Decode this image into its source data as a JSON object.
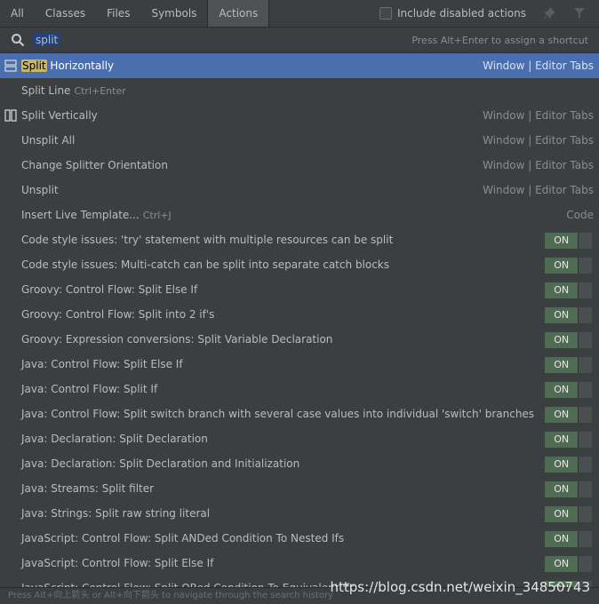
{
  "tabs": [
    "All",
    "Classes",
    "Files",
    "Symbols",
    "Actions"
  ],
  "include_disabled": "Include disabled actions",
  "search": {
    "value": "split",
    "hint": "Press Alt+Enter to assign a shortcut"
  },
  "rows": [
    {
      "pre": "",
      "hl": "Split",
      "post": " Horizontally",
      "shortcut": "",
      "loc": "Window | Editor Tabs",
      "toggle": false,
      "icon": "split-horizontally-icon"
    },
    {
      "pre": "Split Line",
      "hl": "",
      "post": "",
      "shortcut": "Ctrl+Enter",
      "loc": "",
      "toggle": false,
      "icon": ""
    },
    {
      "pre": "Split Vertically",
      "hl": "",
      "post": "",
      "shortcut": "",
      "loc": "Window | Editor Tabs",
      "toggle": false,
      "icon": "split-vertically-icon"
    },
    {
      "pre": "Unsplit All",
      "hl": "",
      "post": "",
      "shortcut": "",
      "loc": "Window | Editor Tabs",
      "toggle": false,
      "icon": ""
    },
    {
      "pre": "Change Splitter Orientation",
      "hl": "",
      "post": "",
      "shortcut": "",
      "loc": "Window | Editor Tabs",
      "toggle": false,
      "icon": ""
    },
    {
      "pre": "Unsplit",
      "hl": "",
      "post": "",
      "shortcut": "",
      "loc": "Window | Editor Tabs",
      "toggle": false,
      "icon": ""
    },
    {
      "pre": "Insert Live Template...",
      "hl": "",
      "post": "",
      "shortcut": "Ctrl+J",
      "loc": "Code",
      "toggle": false,
      "icon": ""
    },
    {
      "pre": "Code style issues: 'try' statement with multiple resources can be split",
      "hl": "",
      "post": "",
      "shortcut": "",
      "loc": "",
      "toggle": true,
      "icon": ""
    },
    {
      "pre": "Code style issues: Multi-catch can be split into separate catch blocks",
      "hl": "",
      "post": "",
      "shortcut": "",
      "loc": "",
      "toggle": true,
      "icon": ""
    },
    {
      "pre": "Groovy: Control Flow: Split Else If",
      "hl": "",
      "post": "",
      "shortcut": "",
      "loc": "",
      "toggle": true,
      "icon": ""
    },
    {
      "pre": "Groovy: Control Flow: Split into 2 if's",
      "hl": "",
      "post": "",
      "shortcut": "",
      "loc": "",
      "toggle": true,
      "icon": ""
    },
    {
      "pre": "Groovy: Expression conversions: Split Variable Declaration",
      "hl": "",
      "post": "",
      "shortcut": "",
      "loc": "",
      "toggle": true,
      "icon": ""
    },
    {
      "pre": "Java: Control Flow: Split Else If",
      "hl": "",
      "post": "",
      "shortcut": "",
      "loc": "",
      "toggle": true,
      "icon": ""
    },
    {
      "pre": "Java: Control Flow: Split If",
      "hl": "",
      "post": "",
      "shortcut": "",
      "loc": "",
      "toggle": true,
      "icon": ""
    },
    {
      "pre": "Java: Control Flow: Split switch branch with several case values into individual 'switch' branches",
      "hl": "",
      "post": "",
      "shortcut": "",
      "loc": "",
      "toggle": true,
      "icon": ""
    },
    {
      "pre": "Java: Declaration: Split Declaration",
      "hl": "",
      "post": "",
      "shortcut": "",
      "loc": "",
      "toggle": true,
      "icon": ""
    },
    {
      "pre": "Java: Declaration: Split Declaration and Initialization",
      "hl": "",
      "post": "",
      "shortcut": "",
      "loc": "",
      "toggle": true,
      "icon": ""
    },
    {
      "pre": "Java: Streams: Split filter",
      "hl": "",
      "post": "",
      "shortcut": "",
      "loc": "",
      "toggle": true,
      "icon": ""
    },
    {
      "pre": "Java: Strings: Split raw string literal",
      "hl": "",
      "post": "",
      "shortcut": "",
      "loc": "",
      "toggle": true,
      "icon": ""
    },
    {
      "pre": "JavaScript: Control Flow: Split ANDed Condition To Nested Ifs",
      "hl": "",
      "post": "",
      "shortcut": "",
      "loc": "",
      "toggle": true,
      "icon": ""
    },
    {
      "pre": "JavaScript: Control Flow: Split Else If",
      "hl": "",
      "post": "",
      "shortcut": "",
      "loc": "",
      "toggle": true,
      "icon": ""
    },
    {
      "pre": "JavaScript: Control Flow: Split ORed Condition To Equivalent Ifs",
      "hl": "",
      "post": "",
      "shortcut": "",
      "loc": "",
      "toggle": true,
      "icon": ""
    }
  ],
  "toggle_label": "ON",
  "footer": "Press Alt+向上箭头 or Alt+向下箭头 to navigate through the search history",
  "watermark": "https://blog.csdn.net/weixin_34850743",
  "colors": {
    "selection": "#4b6eaf",
    "highlight": "#c9b56a",
    "background": "#3c3f41"
  }
}
